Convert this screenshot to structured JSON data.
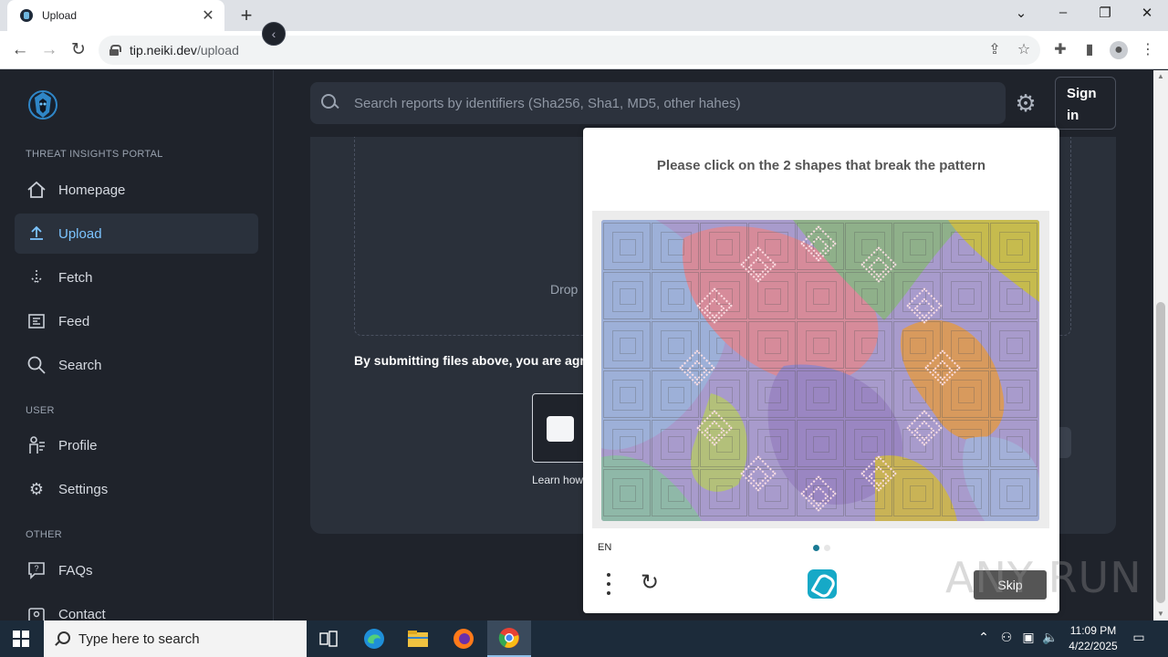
{
  "browser": {
    "tab_title": "Upload",
    "new_tab": "+",
    "url_host": "tip.neiki.dev",
    "url_path": "/upload"
  },
  "sidebar": {
    "sections": {
      "portal": "THREAT INSIGHTS PORTAL",
      "user": "USER",
      "other": "OTHER"
    },
    "items": [
      {
        "label": "Homepage",
        "icon": "home-icon"
      },
      {
        "label": "Upload",
        "icon": "upload-icon",
        "active": true
      },
      {
        "label": "Fetch",
        "icon": "fetch-icon"
      },
      {
        "label": "Feed",
        "icon": "feed-icon"
      },
      {
        "label": "Search",
        "icon": "search-icon"
      },
      {
        "label": "Profile",
        "icon": "profile-icon"
      },
      {
        "label": "Settings",
        "icon": "gear-icon"
      },
      {
        "label": "FAQs",
        "icon": "faq-icon"
      },
      {
        "label": "Contact",
        "icon": "contact-icon"
      }
    ]
  },
  "header": {
    "search_placeholder": "Search reports by identifiers (Sha256, Sha1, MD5, other hahes)",
    "signin_label": "Sign in"
  },
  "main": {
    "drop_text": "Drop",
    "terms_text": "By submitting files above, you are agre",
    "learn_text": "Learn how"
  },
  "captcha": {
    "prompt": "Please click on the 2 shapes that break the pattern",
    "language": "EN",
    "skip_label": "Skip",
    "page_count": 2,
    "current_page": 1
  },
  "watermark": "ANY RUN",
  "taskbar": {
    "search_placeholder": "Type here to search",
    "time": "11:09 PM",
    "date": "4/22/2025"
  },
  "colors": {
    "accent": "#7cc4ff",
    "sidebar_bg": "#1f232b",
    "card_bg": "#2a303a",
    "captcha_logo": "#16a9c7"
  }
}
